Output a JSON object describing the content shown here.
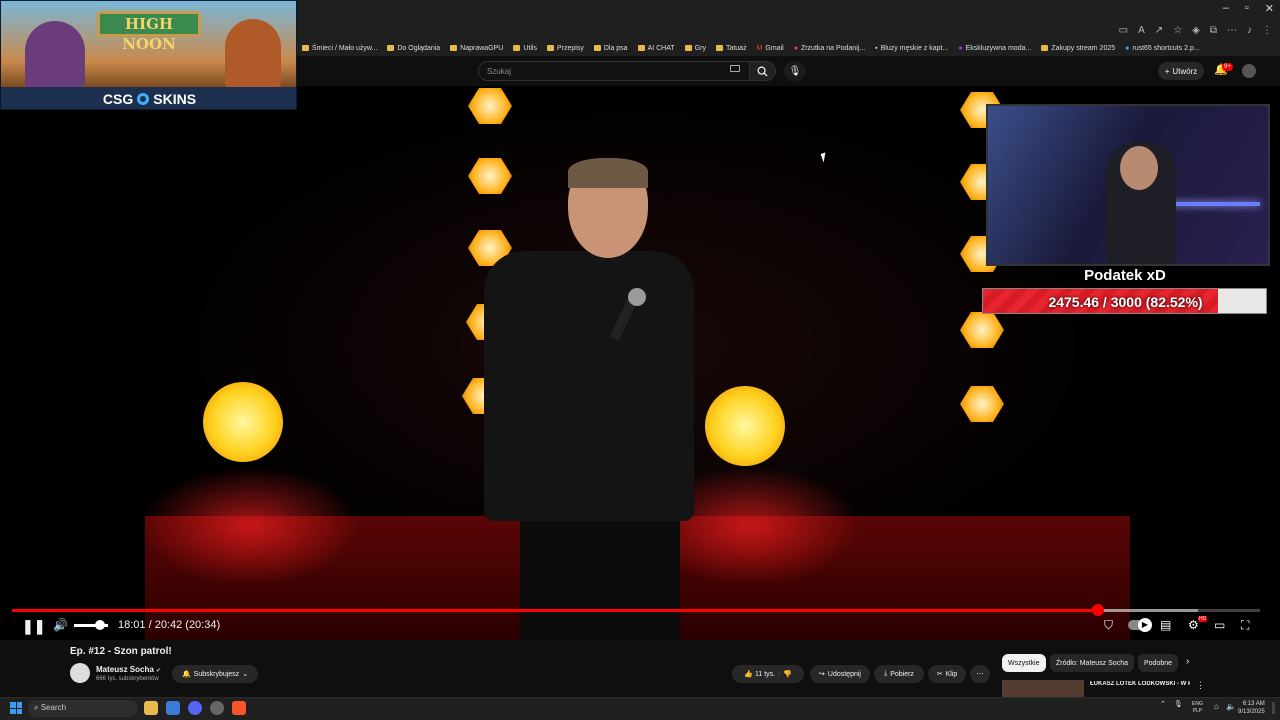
{
  "window": {
    "controls": [
      "–",
      "▫",
      "✕"
    ]
  },
  "toolbar": {
    "icons": [
      "▭",
      "A",
      "↗",
      "☆",
      "◈",
      "⧉",
      "⋯",
      "♪",
      "⋮"
    ]
  },
  "bookmarks": [
    "Śmieci / Mało używ...",
    "Do Oglądania",
    "NaprawaGPU",
    "Utils",
    "Przepisy",
    "Dla psa",
    "AI CHAT",
    "Gry",
    "Tatuaż",
    "Gmail",
    "Zrzutka na Podanij...",
    "Bluzy męskie z kapt...",
    "Ekskluzywna moda...",
    "Zakupy stream 2025",
    "rust65 shortcuts 2.p..."
  ],
  "youtube": {
    "search_placeholder": "Szukaj",
    "create_label": "Utwórz",
    "notif_count": "9+"
  },
  "ad": {
    "sign_text": "HIGH NOON",
    "brand": "CSG",
    "brand2": "SKINS"
  },
  "overlay": {
    "goal_title": "Podatek xD",
    "goal_text": "2475.46 / 3000 (82.52%)",
    "goal_fraction": 0.8252
  },
  "player": {
    "time_display": "18:01 / 20:42 (20:34)",
    "played_fraction": 0.87,
    "buffered_fraction": 0.95,
    "hd_badge": "HD"
  },
  "video": {
    "title": "Ep. #12 - Szon patrol!",
    "channel": "Mateusz Socha",
    "verified": "✔",
    "subscribers": "666 tys. subskrybentów",
    "subscribe_label": "Subskrybujesz",
    "likes": "11 tys.",
    "share_label": "Udostępnij",
    "download_label": "Pobierz",
    "clip_label": "Klip"
  },
  "chips": [
    "Wszystkie",
    "Źródło: Mateusz Socha",
    "Podobne"
  ],
  "recommendation": {
    "title": "ŁUKASZ LOTEK LODKOWSKI - W krzyżu tajemnic (cało..."
  },
  "taskbar": {
    "search_label": "Search",
    "lang_top": "ENG",
    "lang_bottom": "PLP",
    "time": "6:13 AM",
    "date": "9/13/2025"
  },
  "colors": {
    "accent": "#ff0000",
    "goal_fill": "#e8242e"
  }
}
